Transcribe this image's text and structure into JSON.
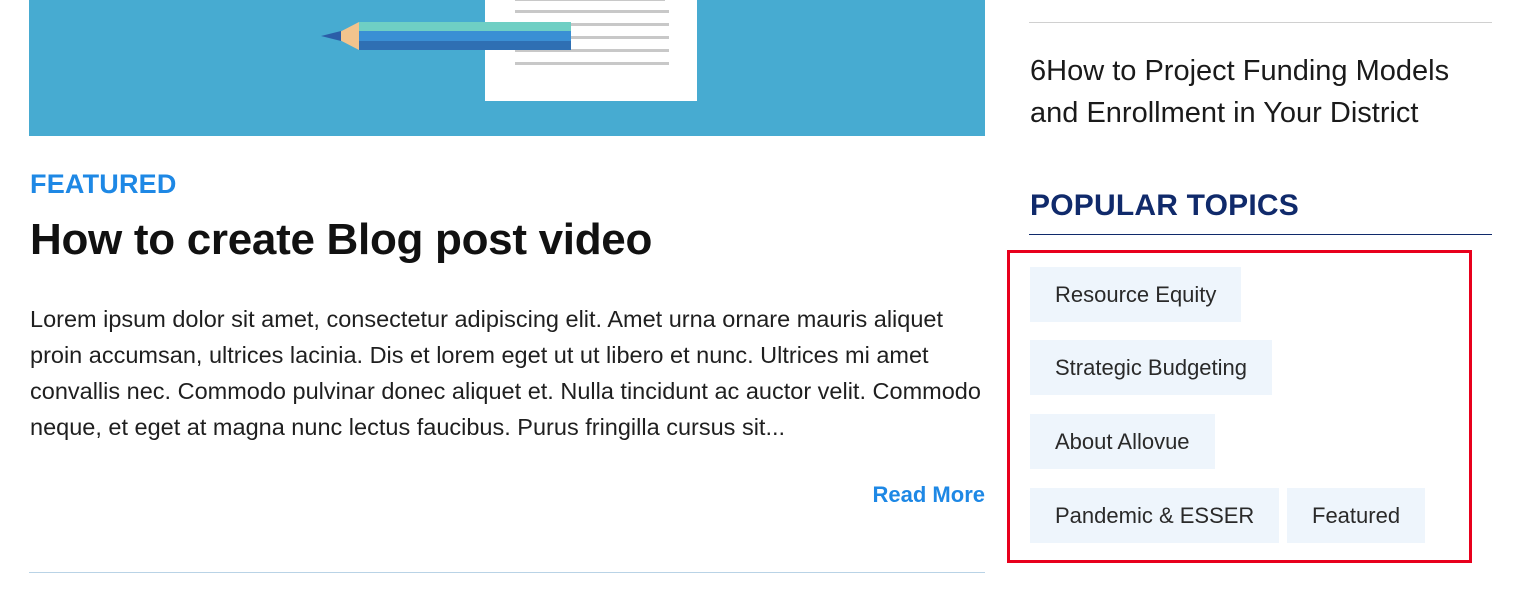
{
  "main": {
    "category_label": "FEATURED",
    "post_title": "How to create Blog post video",
    "excerpt": "Lorem ipsum dolor sit amet, consectetur adipiscing elit. Amet urna ornare mauris aliquet proin accumsan, ultrices lacinia. Dis et lorem eget ut ut libero et nunc. Ultrices mi amet convallis nec. Commodo pulvinar donec aliquet et. Nulla tincidunt ac auctor velit. Commodo neque, et eget at magna nunc lectus faucibus. Purus fringilla cursus sit...",
    "read_more_label": "Read More",
    "hero_icon": "pencil-document-illustration",
    "colors": {
      "hero_background": "#47abd1",
      "accent": "#1e88e5"
    }
  },
  "sidebar": {
    "recent_post_title": "6How to Project Funding Models and Enrollment in Your District",
    "popular_topics": {
      "title": "POPULAR TOPICS",
      "tags": [
        "Resource Equity",
        "Strategic Budgeting",
        "About Allovue",
        "Pandemic & ESSER",
        "Featured"
      ]
    },
    "colors": {
      "heading": "#102a6b",
      "tag_background": "#eef5fc",
      "highlight_border": "#e8001c"
    }
  }
}
